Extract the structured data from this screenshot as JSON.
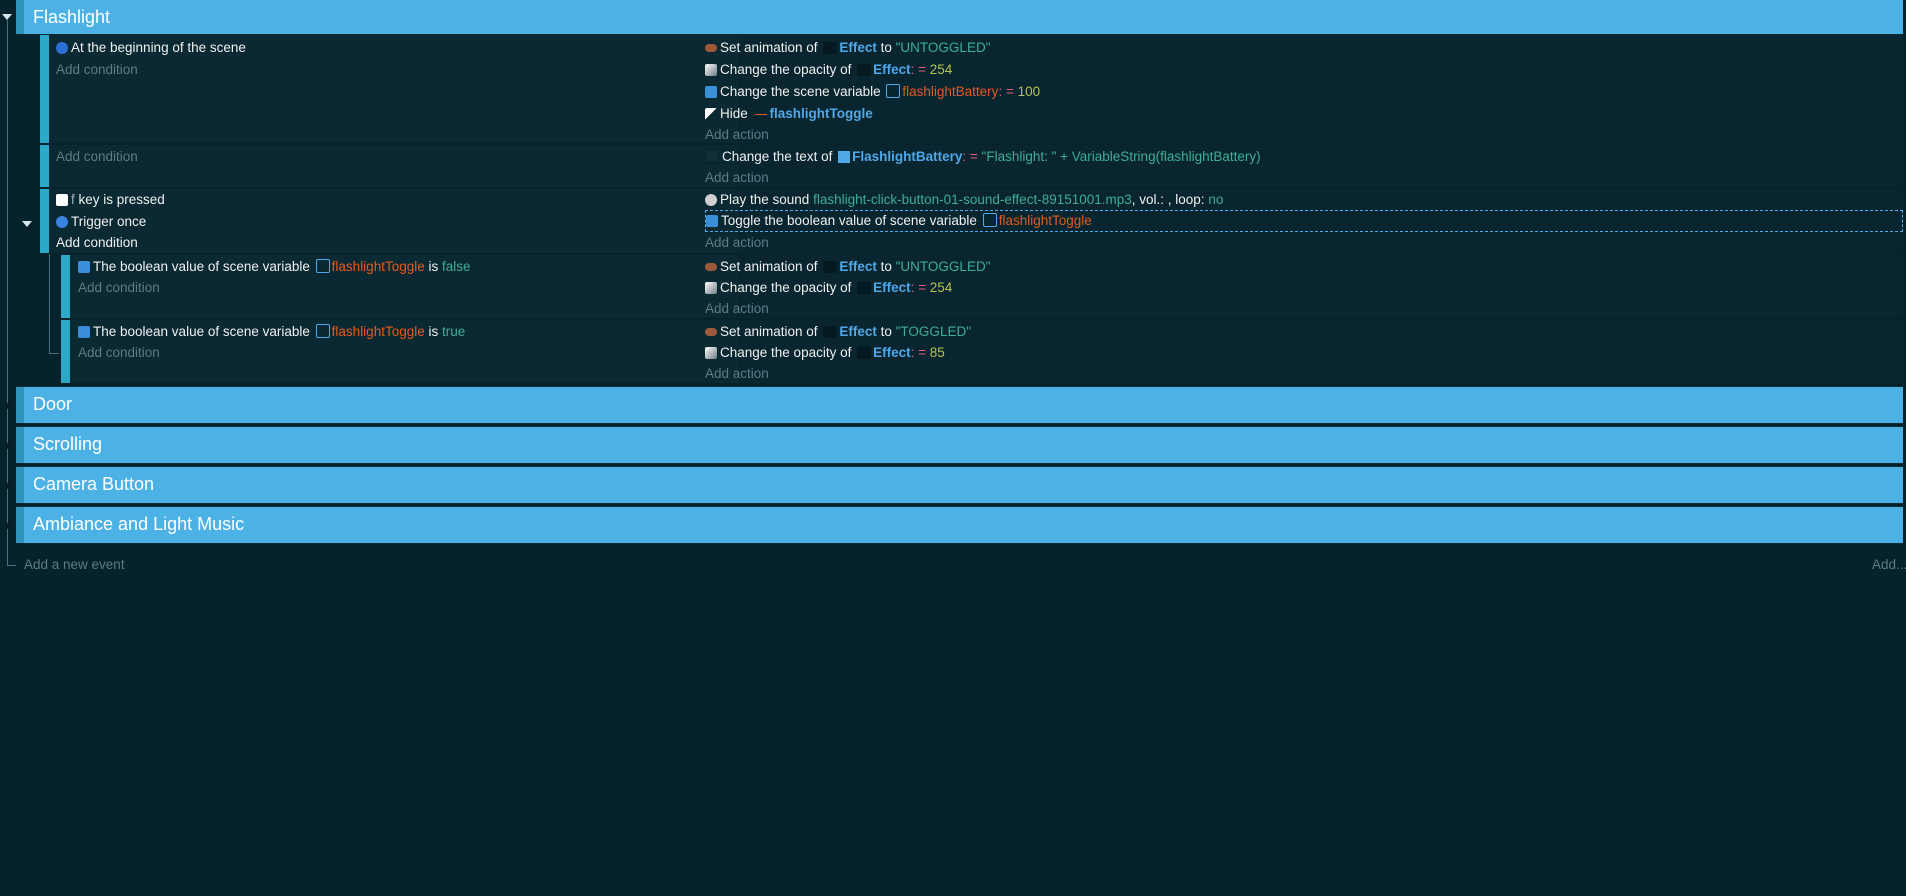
{
  "groups": {
    "flashlight": "Flashlight",
    "door": "Door",
    "scrolling": "Scrolling",
    "camera_button": "Camera Button",
    "ambiance": "Ambiance and Light Music"
  },
  "events": {
    "e1": {
      "condition": "At the beginning of the scene",
      "add_condition": "Add condition",
      "actions": [
        {
          "pre": "Set animation of",
          "obj": "Effect",
          "mid": "to",
          "val": "\"UNTOGGLED\""
        },
        {
          "pre": "Change the opacity of",
          "obj": "Effect",
          "op": ": =",
          "val": "254"
        },
        {
          "pre": "Change the scene variable",
          "var": "flashlightBattery",
          "op": ": =",
          "val": "100"
        },
        {
          "pre": "Hide",
          "obj": "flashlightToggle"
        }
      ],
      "add_action": "Add action"
    },
    "e2": {
      "add_condition": "Add condition",
      "action": {
        "pre": "Change the text of",
        "obj": "FlashlightBattery",
        "op": ": =",
        "val": "\"Flashlight: \" + VariableString(flashlightBattery)"
      },
      "add_action": "Add action"
    },
    "e3": {
      "cond_key_letter": "f",
      "cond_key_rest": "key is pressed",
      "cond_trigger": "Trigger once",
      "add_condition": "Add condition",
      "action_sound": {
        "pre": "Play the sound",
        "file": "flashlight-click-button-01-sound-effect-89151001.mp3",
        "vol": ", vol.: , loop:",
        "loop": "no"
      },
      "action_toggle": {
        "pre": "Toggle the boolean value of scene variable",
        "var": "flashlightToggle"
      },
      "add_action": "Add action"
    },
    "e4": {
      "cond_pre": "The boolean value of scene variable",
      "cond_var": "flashlightToggle",
      "cond_is": "is",
      "cond_val": "false",
      "add_condition": "Add condition",
      "actions": [
        {
          "pre": "Set animation of",
          "obj": "Effect",
          "mid": "to",
          "val": "\"UNTOGGLED\""
        },
        {
          "pre": "Change the opacity of",
          "obj": "Effect",
          "op": ": =",
          "val": "254"
        }
      ],
      "add_action": "Add action"
    },
    "e5": {
      "cond_pre": "The boolean value of scene variable",
      "cond_var": "flashlightToggle",
      "cond_is": "is",
      "cond_val": "true",
      "add_condition": "Add condition",
      "actions": [
        {
          "pre": "Set animation of",
          "obj": "Effect",
          "mid": "to",
          "val": "\"TOGGLED\""
        },
        {
          "pre": "Change the opacity of",
          "obj": "Effect",
          "op": ": =",
          "val": "85"
        }
      ],
      "add_action": "Add action"
    }
  },
  "footer": {
    "add_event": "Add a new event",
    "add_more": "Add..."
  },
  "colors": {
    "background": "#06222c",
    "group_bar": "#4cb2e5",
    "object_blue": "#4fa8e8",
    "string_green": "#3fae93",
    "number_yellow": "#b7c24a",
    "variable_orange": "#e25a1e"
  }
}
